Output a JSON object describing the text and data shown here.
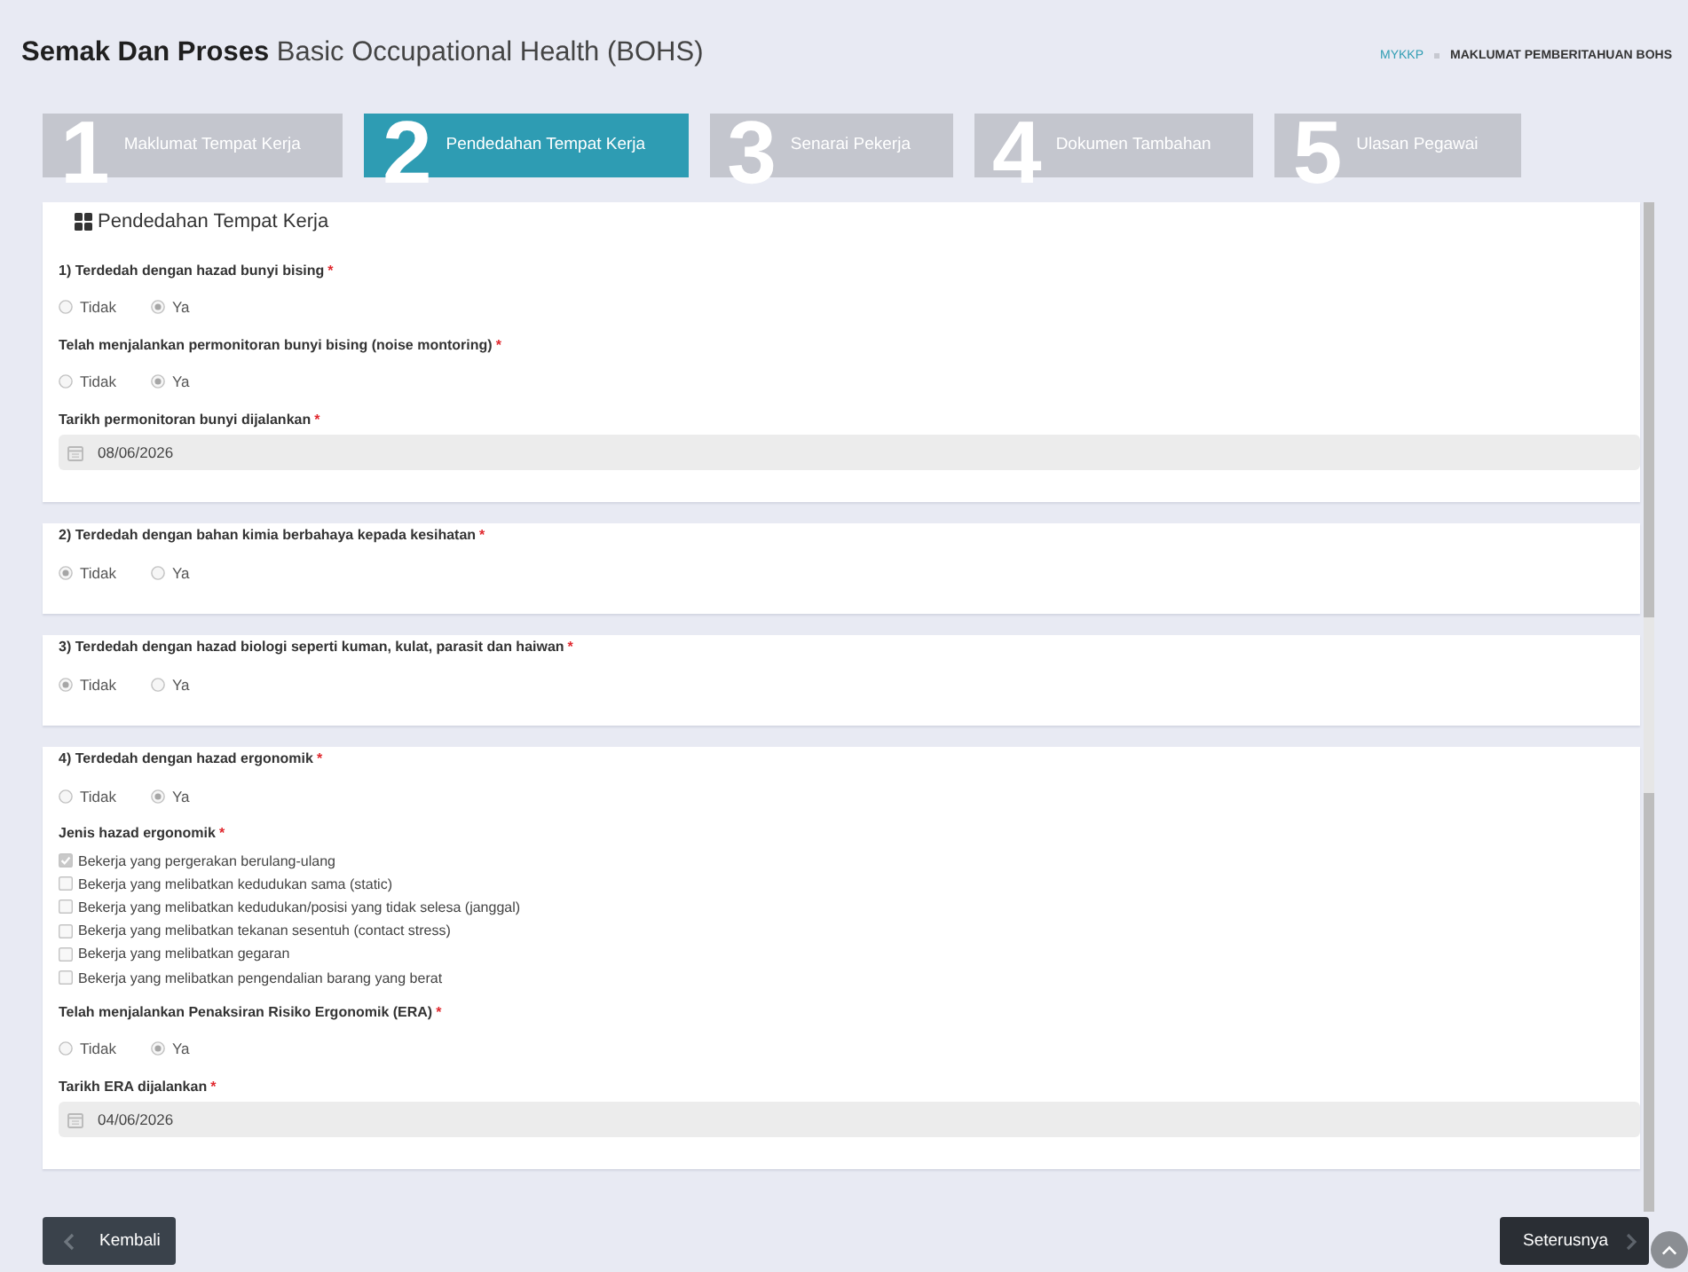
{
  "header": {
    "title": "**Semak Dan Proses** Basic Occupational Health (BOHS)",
    "breadcrumb": [
      {
        "label": "MYKKP",
        "kind": "link"
      },
      {
        "label": "MAKLUMAT PEMBERITAHUAN BOHS",
        "kind": "current"
      }
    ]
  },
  "steps": [
    {
      "number": "1",
      "label": "Maklumat Tempat Kerja",
      "selected": false
    },
    {
      "number": "2",
      "label": "Pendedahan Tempat Kerja",
      "selected": true
    },
    {
      "number": "3",
      "label": "Senarai Pekerja",
      "selected": false
    },
    {
      "number": "4",
      "label": "Dokumen Tambahan",
      "selected": false
    },
    {
      "number": "5",
      "label": "Ulasan Pegawai",
      "selected": false
    }
  ],
  "sections": [
    {
      "heading": "Pendedahan Tempat Kerja",
      "fields": [
        {
          "kind": "radio",
          "label": "1) Terdedah dengan hazad bunyi bising",
          "required_mark": "*",
          "options": [
            {
              "label": "Tidak",
              "selected": false
            },
            {
              "label": "Ya",
              "selected": true
            }
          ]
        },
        {
          "kind": "radio",
          "label": "Telah menjalankan permonitoran bunyi bising (noise montoring)",
          "required_mark": "*",
          "options": [
            {
              "label": "Tidak",
              "selected": false
            },
            {
              "label": "Ya",
              "selected": true
            }
          ]
        },
        {
          "kind": "date",
          "label": "Tarikh permonitoran bunyi dijalankan",
          "required_mark": "*",
          "value": "08/06/2026"
        }
      ]
    },
    {
      "fields": [
        {
          "kind": "radio",
          "label": "2) Terdedah dengan bahan kimia berbahaya kepada kesihatan",
          "required_mark": "*",
          "options": [
            {
              "label": "Tidak",
              "selected": true
            },
            {
              "label": "Ya",
              "selected": false
            }
          ]
        }
      ]
    },
    {
      "fields": [
        {
          "kind": "radio",
          "label": "3) Terdedah dengan hazad biologi seperti kuman, kulat, parasit dan haiwan",
          "required_mark": "*",
          "options": [
            {
              "label": "Tidak",
              "selected": true
            },
            {
              "label": "Ya",
              "selected": false
            }
          ]
        }
      ]
    },
    {
      "fields": [
        {
          "kind": "radio",
          "label": "4) Terdedah dengan hazad ergonomik",
          "required_mark": "*",
          "options": [
            {
              "label": "Tidak",
              "selected": false
            },
            {
              "label": "Ya",
              "selected": true
            }
          ]
        },
        {
          "kind": "checkbox",
          "label": "Jenis hazad ergonomik",
          "required_mark": "*",
          "options": [
            {
              "label": "Bekerja yang pergerakan berulang-ulang",
              "checked": true
            },
            {
              "label": "Bekerja yang melibatkan kedudukan sama (static)",
              "checked": false
            },
            {
              "label": "Bekerja yang melibatkan kedudukan/posisi yang tidak selesa (janggal)",
              "checked": false
            },
            {
              "label": "Bekerja yang melibatkan tekanan sesentuh (contact stress)",
              "checked": false
            },
            {
              "label": "Bekerja yang melibatkan gegaran",
              "checked": false
            },
            {
              "label": "Bekerja yang melibatkan pengendalian barang yang berat",
              "checked": false
            }
          ]
        },
        {
          "kind": "radio",
          "label": "Telah menjalankan Penaksiran Risiko Ergonomik (ERA)",
          "required_mark": "*",
          "options": [
            {
              "label": "Tidak",
              "selected": false
            },
            {
              "label": "Ya",
              "selected": true
            }
          ]
        },
        {
          "kind": "date",
          "label": "Tarikh ERA dijalankan",
          "required_mark": "*",
          "value": "04/06/2026"
        }
      ]
    }
  ],
  "buttons": [
    {
      "label": "Kembali",
      "kind": "back"
    },
    {
      "label": "Seterusnya",
      "kind": "next"
    }
  ]
}
